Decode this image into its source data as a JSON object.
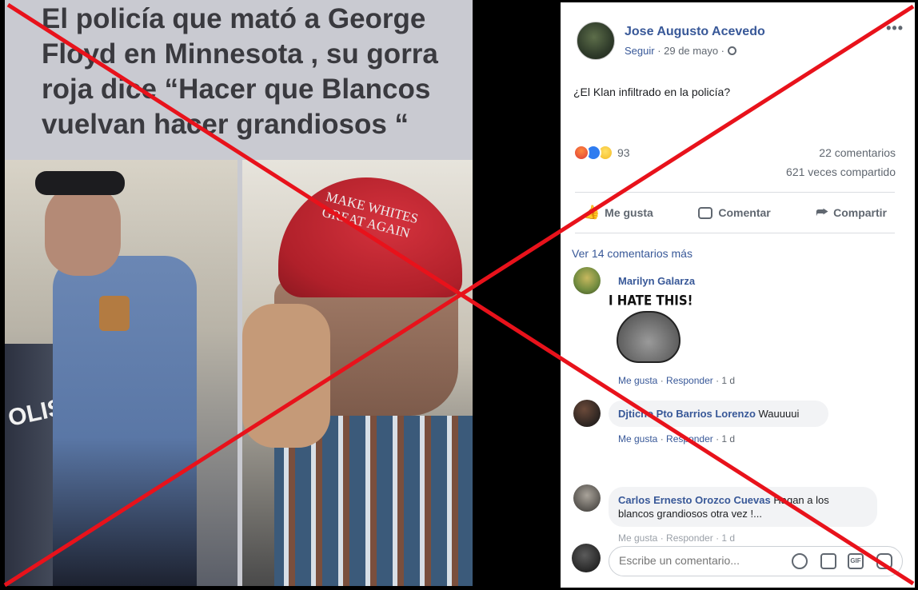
{
  "photo": {
    "headline": "El policía que mató a George\nFloyd en Minnesota , su gorra\nroja dice “Hacer que Blancos\nvuelvan hacer grandiosos “",
    "hat_text": "MAKE WHITES\nGREAT AGAIN",
    "car_text": "OLIS"
  },
  "post": {
    "author": "Jose Augusto Acevedo",
    "follow": "Seguir",
    "date_sep": " · 29 de mayo · ",
    "more": "•••",
    "text": "¿El Klan infiltrado en la policía?",
    "reaction_count": "93",
    "comments_count": "22 comentarios",
    "shares_count": "621 veces compartido"
  },
  "actions": {
    "like": "Me gusta",
    "comment": "Comentar",
    "share": "Compartir"
  },
  "comments": {
    "view_more": "Ver 14 comentarios más",
    "items": [
      {
        "name": "Marilyn Galarza",
        "sticker_text": "I HATE THIS!",
        "like": "Me gusta",
        "sep": " · ",
        "reply": "Responder",
        "time": " · 1 d"
      },
      {
        "name": "Djticho Pto Barrios Lorenzo",
        "text": " Wauuuui",
        "like": "Me gusta",
        "sep": " · ",
        "reply": "Responder",
        "time": " · 1 d"
      },
      {
        "name": "Carlos Ernesto Orozco Cuevas",
        "text": " Hagan a los blancos grandiosos otra vez !...",
        "meta": "Me gusta · Responder · 1 d"
      }
    ]
  },
  "composer": {
    "placeholder": "Escribe un comentario...",
    "gif": "GIF"
  },
  "overlay": {
    "color": "#e8121b"
  }
}
